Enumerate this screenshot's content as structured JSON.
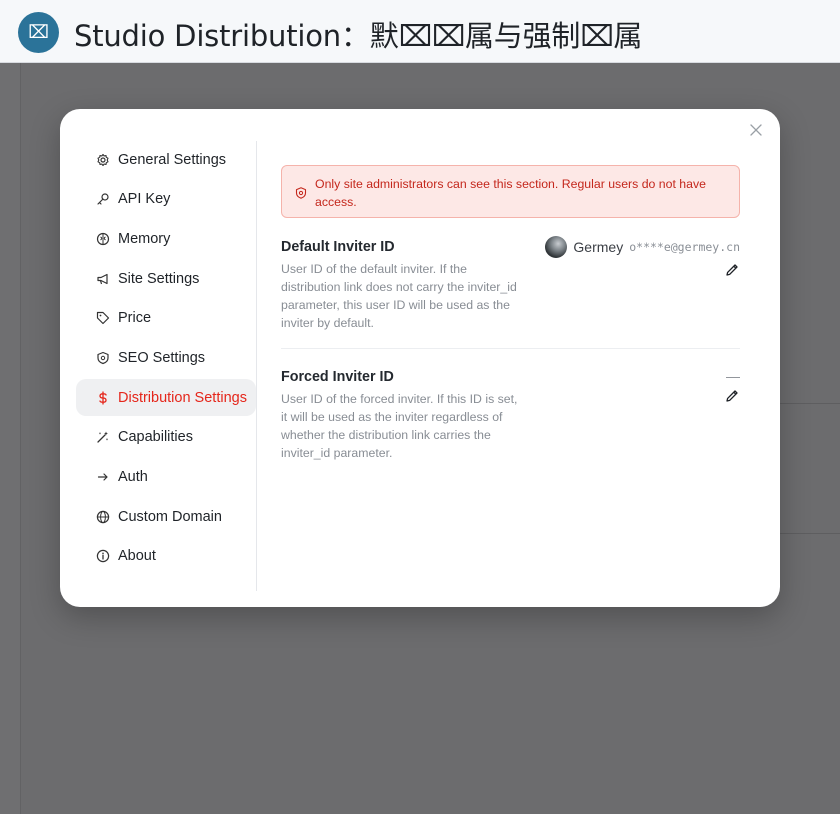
{
  "header": {
    "logo_glyph": "⌧",
    "title": "Studio Distribution：默⌧⌧属与强制⌧属"
  },
  "modal": {
    "nav": [
      {
        "label": "General Settings",
        "icon": "gear-icon"
      },
      {
        "label": "API Key",
        "icon": "key-icon"
      },
      {
        "label": "Memory",
        "icon": "brain-icon"
      },
      {
        "label": "Site Settings",
        "icon": "megaphone-icon"
      },
      {
        "label": "Price",
        "icon": "tag-icon"
      },
      {
        "label": "SEO Settings",
        "icon": "shield-icon"
      },
      {
        "label": "Distribution Settings",
        "icon": "dollar-icon",
        "active": true
      },
      {
        "label": "Capabilities",
        "icon": "magic-wand-icon"
      },
      {
        "label": "Auth",
        "icon": "arrow-right-icon"
      },
      {
        "label": "Custom Domain",
        "icon": "globe-icon"
      },
      {
        "label": "About",
        "icon": "info-icon"
      }
    ],
    "alert": {
      "text": "Only site administrators can see this section. Regular users do not have access.",
      "icon": "shield-alert-icon"
    },
    "default_inviter": {
      "title": "Default Inviter ID",
      "description": "User ID of the default inviter. If the distribution link does not carry the inviter_id parameter, this user ID will be used as the inviter by default.",
      "user_name": "Germey",
      "user_email": "o****e@germey.cn"
    },
    "forced_inviter": {
      "title": "Forced Inviter ID",
      "description": "User ID of the forced inviter. If this ID is set, it will be used as the inviter regardless of whether the distribution link carries the inviter_id parameter.",
      "value": "—"
    }
  },
  "colors": {
    "accent": "#e5261b",
    "alert_bg": "#fde8e6",
    "logo_bg": "#2b7399"
  }
}
